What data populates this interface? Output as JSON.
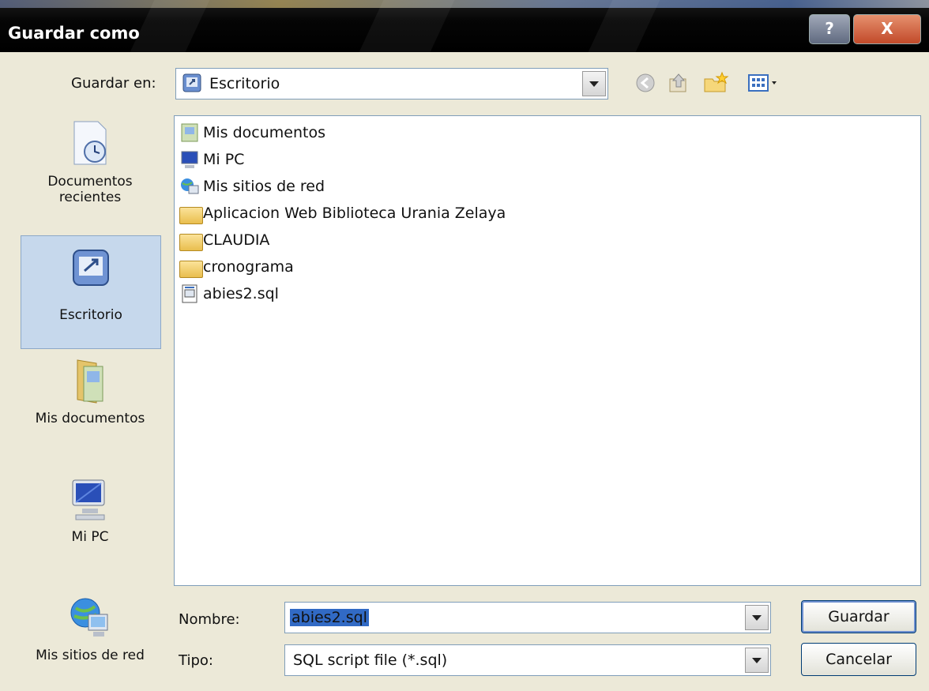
{
  "window": {
    "title": "Guardar como",
    "help_label": "?",
    "close_label": "X"
  },
  "save_in": {
    "label": "Guardar en:",
    "value": "Escritorio"
  },
  "toolbar": {
    "icons": [
      "back-icon",
      "up-folder-icon",
      "new-folder-icon",
      "views-menu-icon"
    ]
  },
  "places": [
    {
      "label": "Documentos recientes",
      "icon": "recent-documents-icon"
    },
    {
      "label": "Escritorio",
      "icon": "desktop-icon",
      "selected": true
    },
    {
      "label": "Mis documentos",
      "icon": "my-documents-icon"
    },
    {
      "label": "Mi PC",
      "icon": "my-computer-icon"
    },
    {
      "label": "Mis sitios de red",
      "icon": "network-places-icon"
    }
  ],
  "files": [
    {
      "name": "Mis documentos",
      "icon": "my-documents-icon"
    },
    {
      "name": "Mi PC",
      "icon": "my-computer-icon"
    },
    {
      "name": "Mis sitios de red",
      "icon": "network-places-icon"
    },
    {
      "name": "Aplicacion Web Biblioteca Urania Zelaya",
      "icon": "folder-icon"
    },
    {
      "name": "CLAUDIA",
      "icon": "folder-icon"
    },
    {
      "name": "cronograma",
      "icon": "folder-icon"
    },
    {
      "name": "abies2.sql",
      "icon": "sql-file-icon"
    }
  ],
  "filename": {
    "label": "Nombre:",
    "value": "abies2.sql"
  },
  "filetype": {
    "label": "Tipo:",
    "value": "SQL script file (*.sql)"
  },
  "buttons": {
    "save": "Guardar",
    "cancel": "Cancelar"
  }
}
